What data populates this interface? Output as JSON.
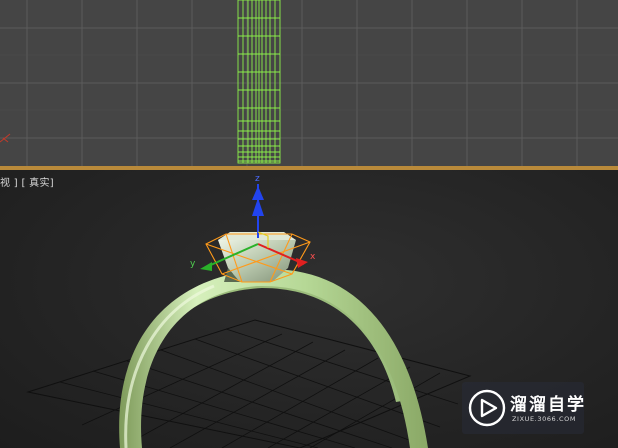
{
  "top_viewport": {
    "background": "#454545",
    "grid_color": "#5c5c5c",
    "wire_color": "#8cf04a"
  },
  "perspective_viewport": {
    "label_part1": "视 ]",
    "label_part2": "[ 真实]",
    "grid_color": "#101010",
    "ring_color": "#c8e6a8",
    "selection_color": "#ff9a1a"
  },
  "gizmo": {
    "x_label": "x",
    "y_label": "y",
    "z_label": "z",
    "x_color": "#e02020",
    "y_color": "#2ab22a",
    "z_color": "#2244ee"
  },
  "watermark": {
    "logo_icon": "play-icon",
    "title": "溜溜自学",
    "url": "ZIXUE.3066.COM"
  }
}
